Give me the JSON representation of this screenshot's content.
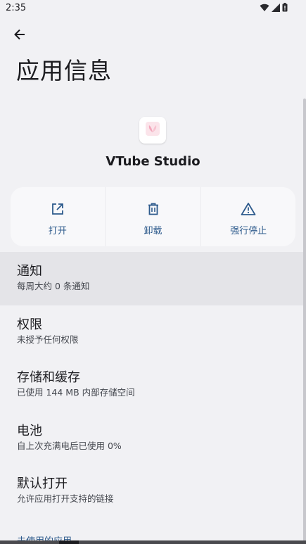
{
  "status_bar": {
    "time": "2:35",
    "icons": [
      "wifi-icon",
      "signal-icon",
      "battery-icon"
    ]
  },
  "header": {
    "back_icon": "arrow-left-icon",
    "title": "应用信息"
  },
  "app": {
    "name": "VTube Studio",
    "icon": "app-logo-icon"
  },
  "actions": [
    {
      "label": "打开",
      "icon": "open-external-icon"
    },
    {
      "label": "卸载",
      "icon": "trash-icon"
    },
    {
      "label": "强行停止",
      "icon": "warning-icon"
    }
  ],
  "settings": [
    {
      "title": "通知",
      "subtitle": "每周大约 0 条通知"
    },
    {
      "title": "权限",
      "subtitle": "未授予任何权限"
    },
    {
      "title": "存储和缓存",
      "subtitle": "已使用 144 MB 内部存储空间"
    },
    {
      "title": "电池",
      "subtitle": "自上次充满电后已使用 0%"
    },
    {
      "title": "默认打开",
      "subtitle": "允许应用打开支持的链接"
    }
  ],
  "section_header": "未使用的应用",
  "colors": {
    "background": "#f1f1f4",
    "accent": "#2d5a8c",
    "highlight": "#e4e4e8",
    "card": "#f8f8fa"
  }
}
